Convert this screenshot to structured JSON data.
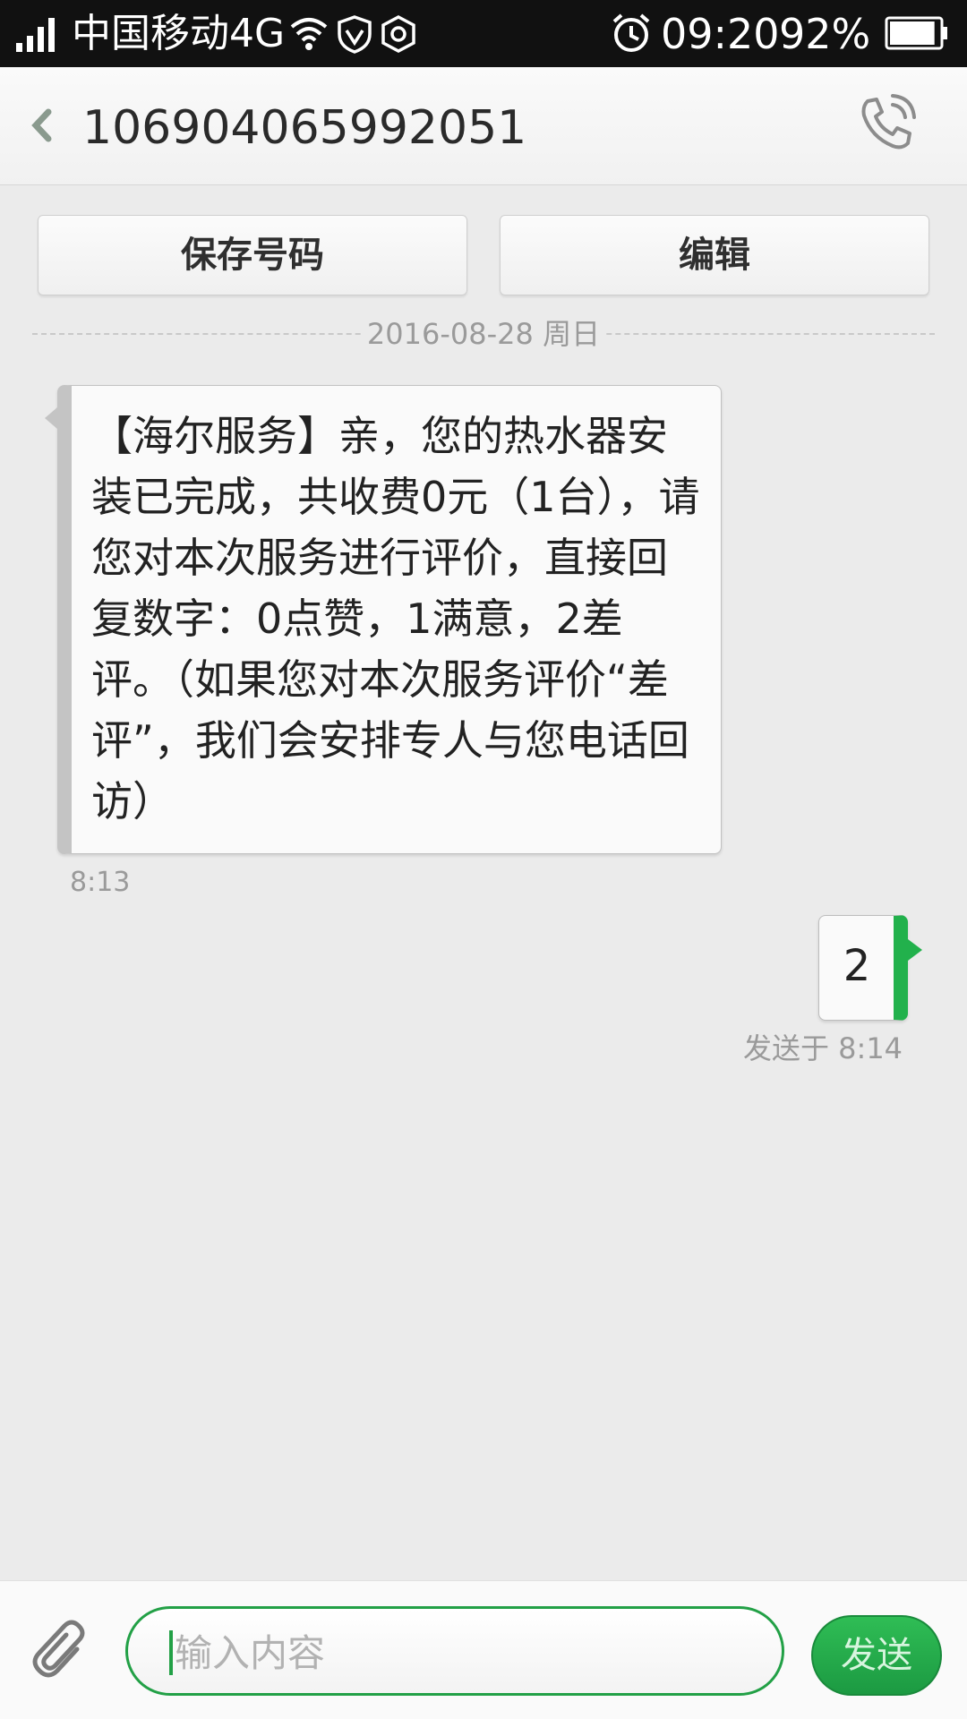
{
  "status_bar": {
    "carrier": "中国移动4G",
    "time": "09:20",
    "battery_percent": "92%",
    "battery_level": 0.92,
    "icons": [
      "signal-icon",
      "wifi-icon",
      "shield-icon",
      "hexagon-icon",
      "alarm-icon",
      "battery-icon"
    ]
  },
  "header": {
    "title": "106904065992051",
    "back_icon": "chevron-left-icon",
    "call_icon": "phone-icon"
  },
  "actions": {
    "save_label": "保存号码",
    "edit_label": "编辑"
  },
  "conversation": {
    "date": "2016-08-28 周日",
    "incoming": {
      "text": "【海尔服务】亲，您的热水器安装已完成，共收费0元（1台），请您对本次服务进行评价，直接回复数字：0点赞，1满意，2差评。（如果您对本次服务评价“差评”，我们会安排专人与您电话回访）",
      "time": "8:13"
    },
    "outgoing": {
      "text": "2",
      "time": "发送于 8:14"
    }
  },
  "composer": {
    "placeholder": "输入内容",
    "value": "",
    "send_label": "发送",
    "attach_icon": "paperclip-icon"
  },
  "colors": {
    "accent": "#22a046",
    "status_bar": "#111111",
    "background": "#ebebeb"
  }
}
